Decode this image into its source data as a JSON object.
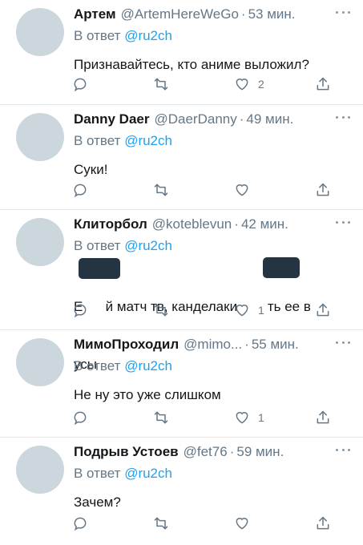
{
  "reply_prefix": "В ответ",
  "colors": {
    "accent": "#1da1f2",
    "secondary_text": "#657786",
    "divider": "#e1e8ed",
    "avatar_placeholder": "#ccd6dd"
  },
  "tweets": [
    {
      "name": "Артем",
      "handle": "@ArtemHereWeGo",
      "time": "53 мин.",
      "reply_to": "@ru2ch",
      "text": "Признавайтесь, кто аниме выложил?",
      "likes": "2"
    },
    {
      "name": "Danny Daer",
      "handle": "@DaerDanny",
      "time": "49 мин.",
      "reply_to": "@ru2ch",
      "text": "Суки!",
      "likes": ""
    },
    {
      "name": "Клиторбол",
      "handle": "@koteblevun",
      "time": "42 мин.",
      "reply_to": "@ru2ch",
      "text_line1": "Е      й матч тв, канделаки        ть ее в",
      "text_line2": "усы",
      "likes": "1"
    },
    {
      "name": "МимоПроходил",
      "handle": "@mimo...",
      "time": "55 мин.",
      "reply_to": "@ru2ch",
      "text": "Не ну это уже слишком",
      "likes": "1"
    },
    {
      "name": "Подрыв Устоев",
      "handle": "@fet76",
      "time": "59 мин.",
      "reply_to": "@ru2ch",
      "text": "Зачем?",
      "likes": ""
    }
  ],
  "icons": {
    "reply": "comment-bubble-icon",
    "retweet": "retweet-icon",
    "like": "heart-icon",
    "share": "share-upload-icon",
    "more": "more-dots-icon"
  }
}
